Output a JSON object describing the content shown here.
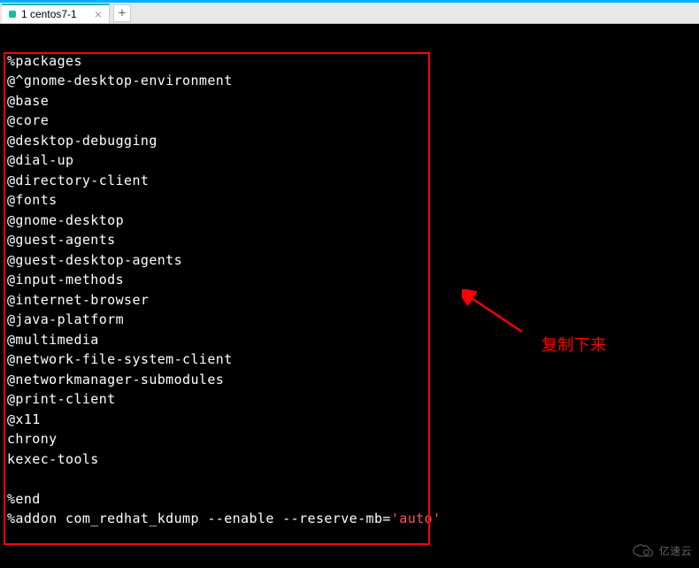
{
  "colors": {
    "titlebar": "#00aeff",
    "highlight_border": "#ff0000",
    "quoted_string": "#ff5555",
    "annotation": "#ff0000"
  },
  "tab": {
    "label": "1 centos7-1",
    "close_glyph": "×",
    "add_glyph": "+"
  },
  "terminal": {
    "lines": [
      "",
      "%packages",
      "@^gnome-desktop-environment",
      "@base",
      "@core",
      "@desktop-debugging",
      "@dial-up",
      "@directory-client",
      "@fonts",
      "@gnome-desktop",
      "@guest-agents",
      "@guest-desktop-agents",
      "@input-methods",
      "@internet-browser",
      "@java-platform",
      "@multimedia",
      "@network-file-system-client",
      "@networkmanager-submodules",
      "@print-client",
      "@x11",
      "chrony",
      "kexec-tools",
      "",
      "%end",
      ""
    ],
    "addon_line_prefix": "%addon com_redhat_kdump --enable --reserve-mb=",
    "addon_quoted": "'auto'"
  },
  "annotation": {
    "text": "复制下来"
  },
  "watermark": {
    "text": "亿速云"
  }
}
